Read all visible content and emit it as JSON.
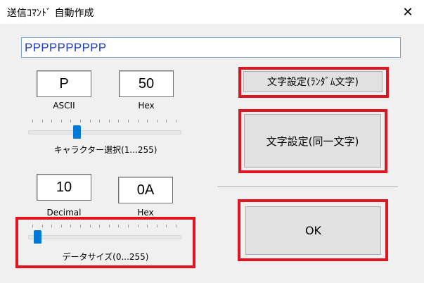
{
  "window": {
    "title": "送信ｺﾏﾝﾄﾞ 自動作成",
    "close_glyph": "✕"
  },
  "text_field": {
    "value": "PPPPPPPPPP"
  },
  "character": {
    "ascii_value": "P",
    "ascii_label": "ASCII",
    "hex_value": "50",
    "hex_label": "Hex",
    "slider_label": "キャラクター選択(1...255)",
    "slider_value": 80,
    "slider_min": 1,
    "slider_max": 255
  },
  "size": {
    "decimal_value": "10",
    "decimal_label": "Decimal",
    "hex_value": "0A",
    "hex_label": "Hex",
    "slider_label": "データサイズ(0...255)",
    "slider_value": 10,
    "slider_min": 0,
    "slider_max": 255
  },
  "buttons": {
    "random": "文字設定(ﾗﾝﾀﾞﾑ文字)",
    "same": "文字設定(同一文字)",
    "ok": "OK"
  },
  "colors": {
    "highlight": "#e0151f",
    "text_value": "#1c3fd0",
    "thumb": "#0078d7"
  },
  "icons": {
    "close": "close-icon",
    "slider_thumb": "slider-thumb"
  }
}
